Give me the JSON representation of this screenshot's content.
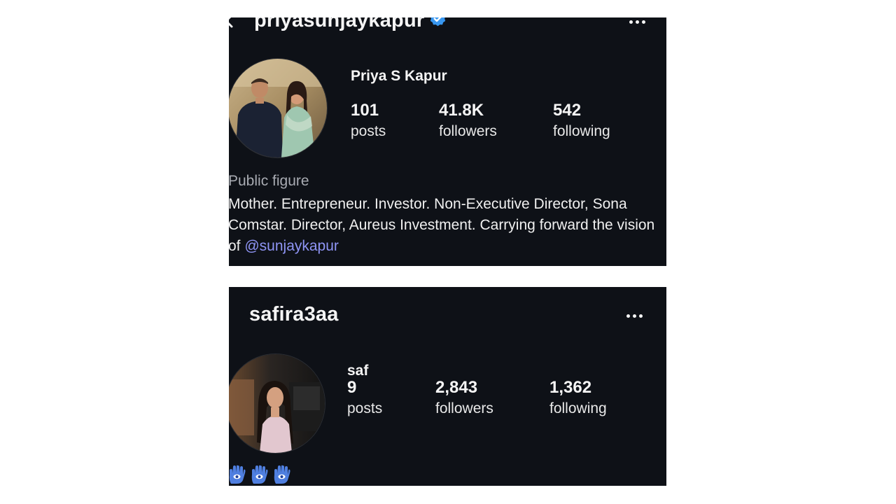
{
  "profiles": [
    {
      "username": "priyasunjaykapur",
      "verified": true,
      "display_name": "Priya S Kapur",
      "stats": [
        {
          "value": "101",
          "label": "posts"
        },
        {
          "value": "41.8K",
          "label": "followers"
        },
        {
          "value": "542",
          "label": "following"
        }
      ],
      "category": "Public figure",
      "bio_text": "Mother. Entrepreneur. Investor. Non-Executive Director, Sona Comstar. Director, Aureus Investment. Carrying forward the vision of ",
      "bio_mention": "@sunjaykapur",
      "icons": [
        "back-arrow-icon",
        "verified-badge-icon",
        "more-options-icon",
        "avatar"
      ],
      "accent_color": "#8f95f5",
      "badge_color": "#3897f0"
    },
    {
      "username": "safira3aa",
      "display_name": "saf",
      "stats": [
        {
          "value": "9",
          "label": "posts"
        },
        {
          "value": "2,843",
          "label": "followers"
        },
        {
          "value": "1,362",
          "label": "following"
        }
      ],
      "bio_emojis": [
        "hamsa-icon",
        "hamsa-icon",
        "hamsa-icon"
      ],
      "icons": [
        "more-options-icon",
        "avatar"
      ]
    }
  ],
  "theme": {
    "background": "#0e1117",
    "page_background": "#ffffff",
    "text": "#f5f5f5",
    "muted_text": "#a8abb2"
  }
}
